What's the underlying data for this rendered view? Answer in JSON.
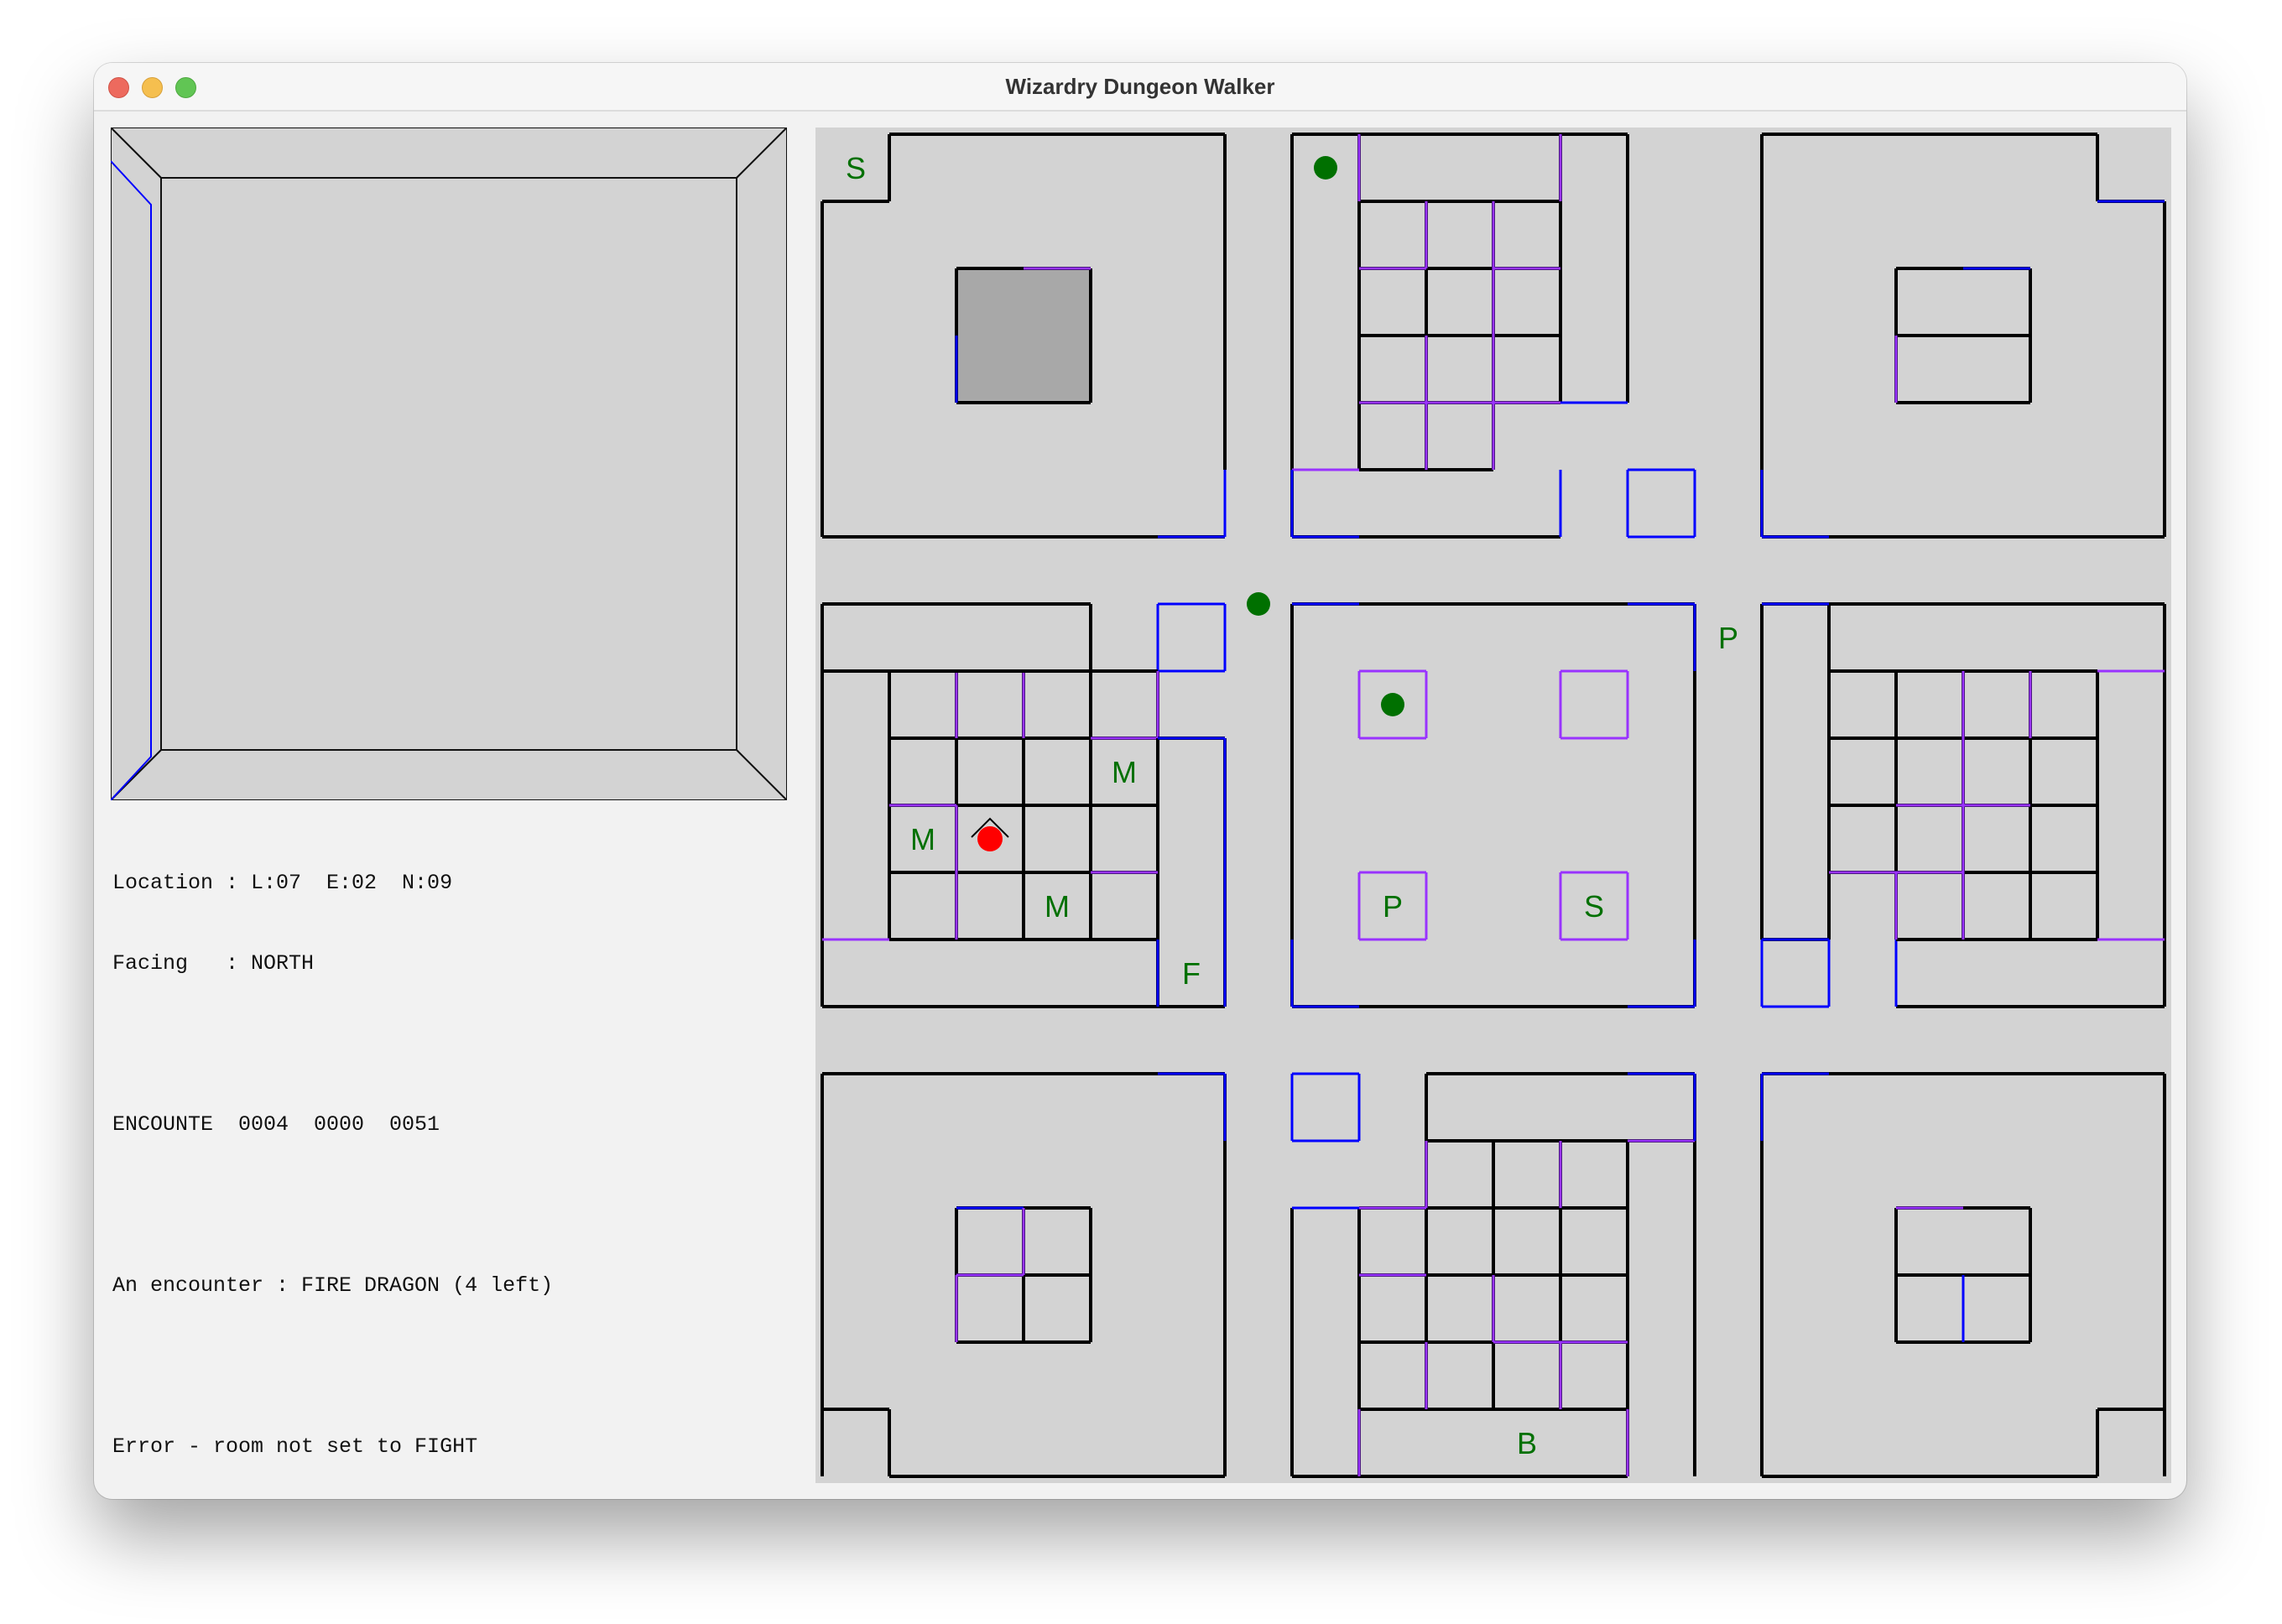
{
  "window": {
    "title": "Wizardry Dungeon Walker",
    "traffic_lights": [
      "close",
      "minimize",
      "maximize"
    ]
  },
  "first_person_view": {
    "description_walls": "corridor view with open passage ahead",
    "left_wall_highlight_color": "#0000ff"
  },
  "status": {
    "location": "Location : L:07  E:02  N:09",
    "facing": "Facing   : NORTH",
    "encounter_counts": "ENCOUNTE  0004  0000  0051",
    "encounter_message": "An encounter : FIRE DRAGON (4 left)",
    "error_message": "Error - room not set to FIGHT"
  },
  "map": {
    "colors": {
      "background": "#d3d3d3",
      "wall": "#000000",
      "door": "#0000ff",
      "secret_door": "#9933ff",
      "marker_text": "#007000",
      "player": "#ff0000",
      "dark_room": "#a8a8a8"
    },
    "letter_markers": [
      {
        "letter": "S",
        "cell": [
          0,
          0
        ]
      },
      {
        "letter": "P",
        "cell": [
          13,
          7
        ]
      },
      {
        "letter": "M",
        "cell": [
          4,
          9
        ]
      },
      {
        "letter": "M",
        "cell": [
          1,
          10
        ]
      },
      {
        "letter": "M",
        "cell": [
          3,
          11
        ]
      },
      {
        "letter": "F",
        "cell": [
          5,
          12
        ]
      },
      {
        "letter": "P",
        "cell": [
          8,
          11
        ]
      },
      {
        "letter": "S",
        "cell": [
          11,
          11
        ]
      },
      {
        "letter": "B",
        "cell": [
          10,
          19
        ]
      }
    ],
    "dot_markers": [
      {
        "cell": [
          7,
          0
        ]
      },
      {
        "cell": [
          6,
          6.5
        ]
      },
      {
        "cell": [
          8,
          8
        ]
      }
    ],
    "player": {
      "cell": [
        2,
        10
      ],
      "facing": "NORTH"
    }
  }
}
